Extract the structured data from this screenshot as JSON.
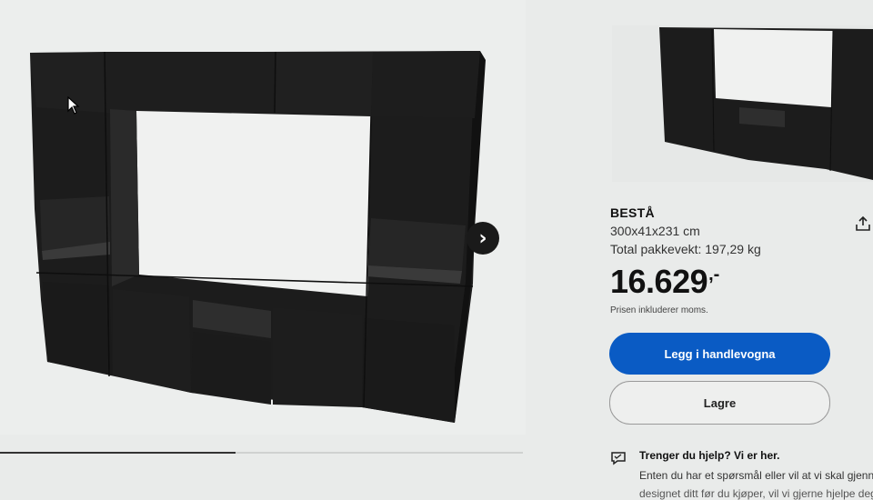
{
  "gallery": {
    "next_icon": "chevron-right-icon",
    "progress_fraction": 0.45
  },
  "product": {
    "name": "BESTÅ",
    "dimensions": "300x41x231 cm",
    "total_package_weight": "Total pakkevekt: 197,29 kg",
    "price": "16.629",
    "price_suffix": ",-",
    "vat_note": "Prisen inkluderer moms."
  },
  "actions": {
    "share_icon": "share-icon",
    "add_to_cart_label": "Legg i handlevogna",
    "save_label": "Lagre"
  },
  "help": {
    "icon": "chat-bubble-icon",
    "title": "Trenger du hjelp? Vi er her.",
    "text": "Enten du har et spørsmål eller vil at vi skal gjennc",
    "text_cut": "designet ditt før du kjøper, vil vi gjerne hjelpe deg"
  },
  "colors": {
    "primary_blue": "#0a5bc4",
    "furniture": "#1b1b1b"
  }
}
